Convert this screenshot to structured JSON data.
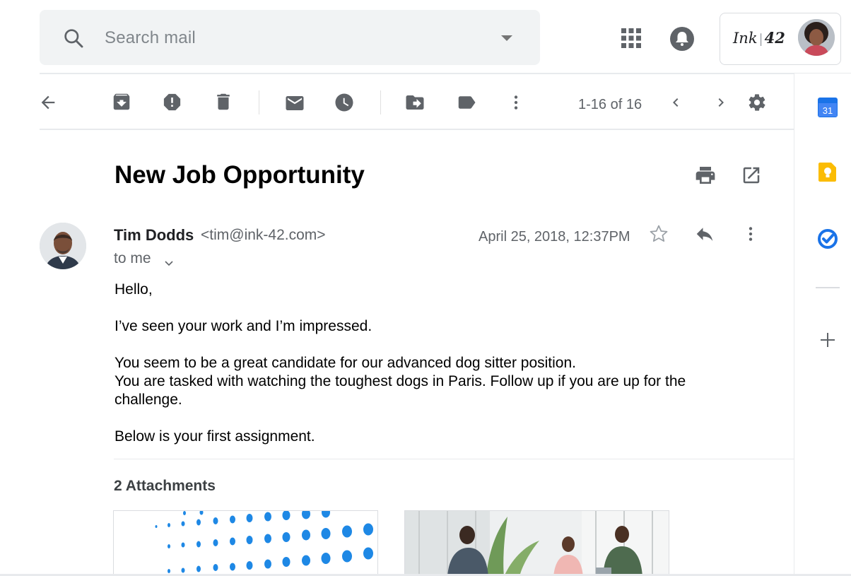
{
  "search": {
    "placeholder": "Search mail"
  },
  "account": {
    "brand_text": "Ink",
    "brand_number": "42"
  },
  "toolbar": {
    "icons": [
      "back-arrow-icon",
      "archive-icon",
      "report-spam-icon",
      "delete-icon",
      "mark-unread-icon",
      "snooze-icon",
      "move-to-icon",
      "label-icon",
      "more-vert-icon"
    ],
    "pager": "1-16 of 16"
  },
  "message": {
    "subject": "New Job Opportunity",
    "sender_name": "Tim Dodds",
    "sender_email": "<tim@ink-42.com>",
    "recipient": "to me",
    "date": "April 25, 2018, 12:37PM",
    "body": [
      "Hello,",
      "I’ve seen your work and I’m impressed.",
      "You seem to be a great candidate for our advanced dog sitter position.",
      "You are tasked with watching the toughest dogs in Paris. Follow up if you are up for the challenge.",
      "Below is your first assignment."
    ]
  },
  "attachments": {
    "title": "2 Attachments"
  },
  "side_panel": {
    "calendar_day": "31",
    "apps": [
      "calendar-icon",
      "keep-icon",
      "tasks-icon",
      "add-addon-icon"
    ]
  },
  "colors": {
    "accent_blue": "#1a73e8",
    "keep_yellow": "#fbbc04",
    "icon_gray": "#5f6368",
    "search_bg": "#f1f3f4"
  }
}
